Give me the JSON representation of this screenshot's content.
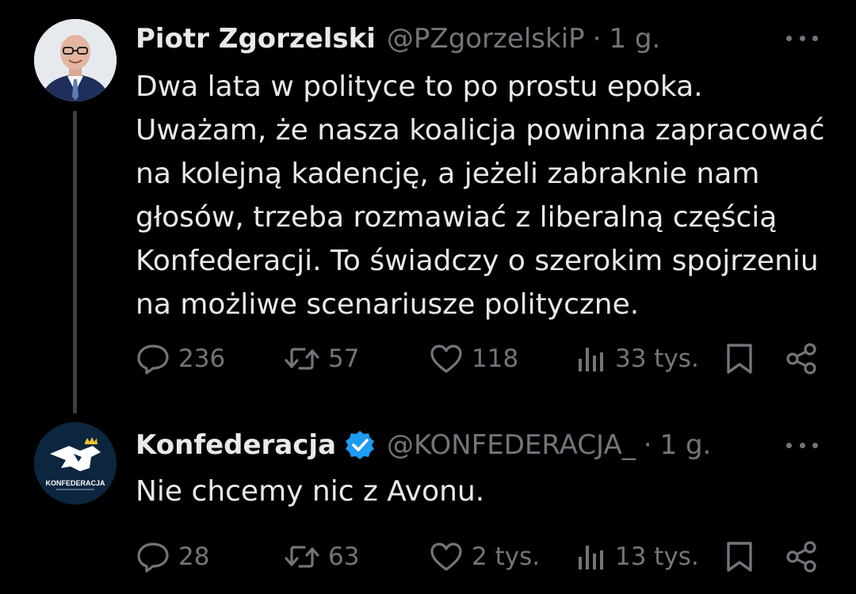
{
  "colors": {
    "background": "#000000",
    "text_primary": "#e7e9ea",
    "text_secondary": "#71767b",
    "verified_badge": "#1d9bf0",
    "thread_line": "#3b3f44"
  },
  "tweets": [
    {
      "author_name": "Piotr Zgorzelski",
      "handle": "@PZgorzelskiP",
      "separator": "·",
      "time": "1 g.",
      "verified": false,
      "text_lines": [
        "Dwa lata w polityce to po prostu epoka.",
        "Uważam, że nasza koalicja powinna zapracować",
        "na kolejną kadencję, a jeżeli zabraknie nam",
        "głosów, trzeba rozmawiać z liberalną częścią",
        "Konfederacji. To świadczy o szerokim spojrzeniu",
        "na możliwe scenariusze polityczne."
      ],
      "stats": {
        "replies": "236",
        "retweets": "57",
        "likes": "118",
        "views": "33 tys."
      },
      "icons": [
        "reply-icon",
        "retweet-icon",
        "like-icon",
        "views-icon",
        "bookmark-icon",
        "share-icon"
      ]
    },
    {
      "author_name": "Konfederacja",
      "handle": "@KONFEDERACJA_",
      "separator": "·",
      "time": "1 g.",
      "verified": true,
      "avatar_logo_text": "KONFEDERACJA",
      "text_lines": [
        "Nie chcemy nic z Avonu."
      ],
      "stats": {
        "replies": "28",
        "retweets": "63",
        "likes": "2 tys.",
        "views": "13 tys."
      },
      "icons": [
        "reply-icon",
        "retweet-icon",
        "like-icon",
        "views-icon",
        "bookmark-icon",
        "share-icon"
      ]
    }
  ]
}
